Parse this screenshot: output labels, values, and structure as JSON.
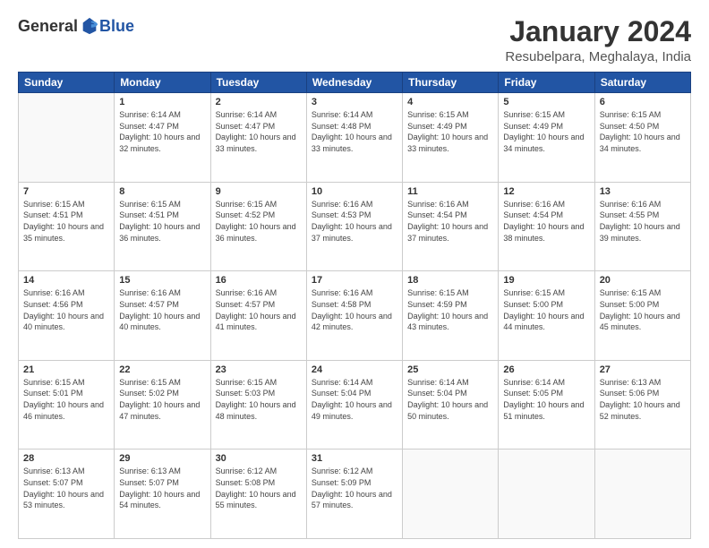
{
  "header": {
    "logo_general": "General",
    "logo_blue": "Blue",
    "month_title": "January 2024",
    "location": "Resubelpara, Meghalaya, India"
  },
  "weekdays": [
    "Sunday",
    "Monday",
    "Tuesday",
    "Wednesday",
    "Thursday",
    "Friday",
    "Saturday"
  ],
  "weeks": [
    [
      {
        "day": "",
        "sunrise": "",
        "sunset": "",
        "daylight": ""
      },
      {
        "day": "1",
        "sunrise": "6:14 AM",
        "sunset": "4:47 PM",
        "daylight": "10 hours and 32 minutes."
      },
      {
        "day": "2",
        "sunrise": "6:14 AM",
        "sunset": "4:47 PM",
        "daylight": "10 hours and 33 minutes."
      },
      {
        "day": "3",
        "sunrise": "6:14 AM",
        "sunset": "4:48 PM",
        "daylight": "10 hours and 33 minutes."
      },
      {
        "day": "4",
        "sunrise": "6:15 AM",
        "sunset": "4:49 PM",
        "daylight": "10 hours and 33 minutes."
      },
      {
        "day": "5",
        "sunrise": "6:15 AM",
        "sunset": "4:49 PM",
        "daylight": "10 hours and 34 minutes."
      },
      {
        "day": "6",
        "sunrise": "6:15 AM",
        "sunset": "4:50 PM",
        "daylight": "10 hours and 34 minutes."
      }
    ],
    [
      {
        "day": "7",
        "sunrise": "6:15 AM",
        "sunset": "4:51 PM",
        "daylight": "10 hours and 35 minutes."
      },
      {
        "day": "8",
        "sunrise": "6:15 AM",
        "sunset": "4:51 PM",
        "daylight": "10 hours and 36 minutes."
      },
      {
        "day": "9",
        "sunrise": "6:15 AM",
        "sunset": "4:52 PM",
        "daylight": "10 hours and 36 minutes."
      },
      {
        "day": "10",
        "sunrise": "6:16 AM",
        "sunset": "4:53 PM",
        "daylight": "10 hours and 37 minutes."
      },
      {
        "day": "11",
        "sunrise": "6:16 AM",
        "sunset": "4:54 PM",
        "daylight": "10 hours and 37 minutes."
      },
      {
        "day": "12",
        "sunrise": "6:16 AM",
        "sunset": "4:54 PM",
        "daylight": "10 hours and 38 minutes."
      },
      {
        "day": "13",
        "sunrise": "6:16 AM",
        "sunset": "4:55 PM",
        "daylight": "10 hours and 39 minutes."
      }
    ],
    [
      {
        "day": "14",
        "sunrise": "6:16 AM",
        "sunset": "4:56 PM",
        "daylight": "10 hours and 40 minutes."
      },
      {
        "day": "15",
        "sunrise": "6:16 AM",
        "sunset": "4:57 PM",
        "daylight": "10 hours and 40 minutes."
      },
      {
        "day": "16",
        "sunrise": "6:16 AM",
        "sunset": "4:57 PM",
        "daylight": "10 hours and 41 minutes."
      },
      {
        "day": "17",
        "sunrise": "6:16 AM",
        "sunset": "4:58 PM",
        "daylight": "10 hours and 42 minutes."
      },
      {
        "day": "18",
        "sunrise": "6:15 AM",
        "sunset": "4:59 PM",
        "daylight": "10 hours and 43 minutes."
      },
      {
        "day": "19",
        "sunrise": "6:15 AM",
        "sunset": "5:00 PM",
        "daylight": "10 hours and 44 minutes."
      },
      {
        "day": "20",
        "sunrise": "6:15 AM",
        "sunset": "5:00 PM",
        "daylight": "10 hours and 45 minutes."
      }
    ],
    [
      {
        "day": "21",
        "sunrise": "6:15 AM",
        "sunset": "5:01 PM",
        "daylight": "10 hours and 46 minutes."
      },
      {
        "day": "22",
        "sunrise": "6:15 AM",
        "sunset": "5:02 PM",
        "daylight": "10 hours and 47 minutes."
      },
      {
        "day": "23",
        "sunrise": "6:15 AM",
        "sunset": "5:03 PM",
        "daylight": "10 hours and 48 minutes."
      },
      {
        "day": "24",
        "sunrise": "6:14 AM",
        "sunset": "5:04 PM",
        "daylight": "10 hours and 49 minutes."
      },
      {
        "day": "25",
        "sunrise": "6:14 AM",
        "sunset": "5:04 PM",
        "daylight": "10 hours and 50 minutes."
      },
      {
        "day": "26",
        "sunrise": "6:14 AM",
        "sunset": "5:05 PM",
        "daylight": "10 hours and 51 minutes."
      },
      {
        "day": "27",
        "sunrise": "6:13 AM",
        "sunset": "5:06 PM",
        "daylight": "10 hours and 52 minutes."
      }
    ],
    [
      {
        "day": "28",
        "sunrise": "6:13 AM",
        "sunset": "5:07 PM",
        "daylight": "10 hours and 53 minutes."
      },
      {
        "day": "29",
        "sunrise": "6:13 AM",
        "sunset": "5:07 PM",
        "daylight": "10 hours and 54 minutes."
      },
      {
        "day": "30",
        "sunrise": "6:12 AM",
        "sunset": "5:08 PM",
        "daylight": "10 hours and 55 minutes."
      },
      {
        "day": "31",
        "sunrise": "6:12 AM",
        "sunset": "5:09 PM",
        "daylight": "10 hours and 57 minutes."
      },
      {
        "day": "",
        "sunrise": "",
        "sunset": "",
        "daylight": ""
      },
      {
        "day": "",
        "sunrise": "",
        "sunset": "",
        "daylight": ""
      },
      {
        "day": "",
        "sunrise": "",
        "sunset": "",
        "daylight": ""
      }
    ]
  ]
}
